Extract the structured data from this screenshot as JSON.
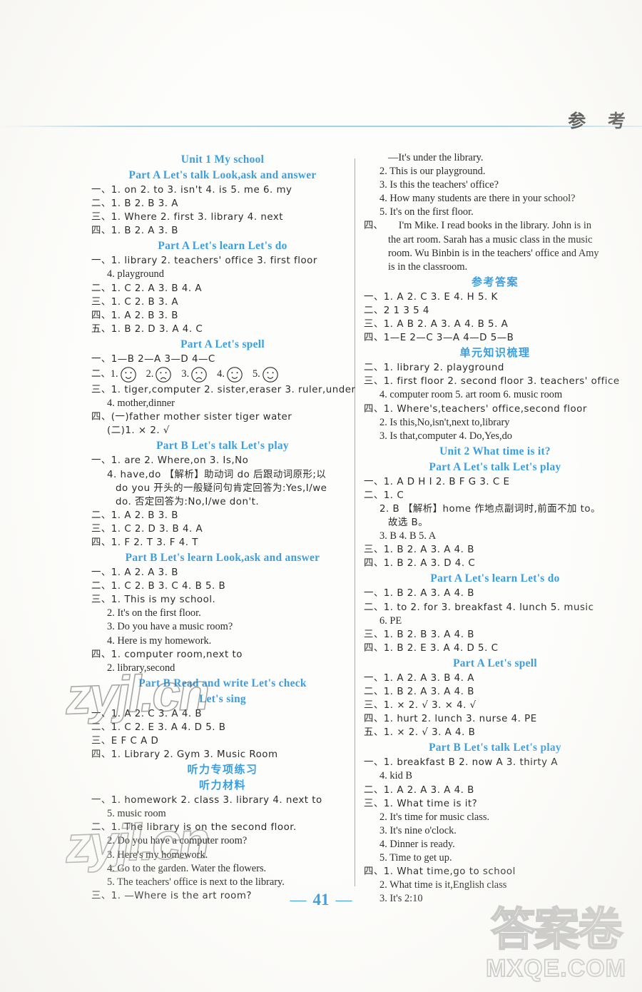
{
  "page": {
    "header_title": "参 考",
    "page_number": "41",
    "page_number_dash": "—"
  },
  "watermarks": {
    "left_upper": "zyjl.cn",
    "left_lower": "zyjl.cn",
    "corner_cn": "答案卷",
    "corner_domain": "MXQE.COM"
  },
  "left_column": [
    {
      "type": "heading",
      "text": "Unit 1   My school"
    },
    {
      "type": "heading",
      "text": "Part A   Let's talk   Look,ask and answer"
    },
    {
      "type": "line",
      "text": "一、1. on  2. to  3. isn't  4. is  5. me  6. my"
    },
    {
      "type": "line",
      "text": "二、1. B  2. B  3. A"
    },
    {
      "type": "line",
      "text": "三、1. Where  2. first  3. library  4. next"
    },
    {
      "type": "line",
      "text": "四、1. B  2. A  3. B"
    },
    {
      "type": "heading",
      "text": "Part A   Let's learn   Let's do"
    },
    {
      "type": "line",
      "text": "一、1. library  2. teachers' office  3. first floor"
    },
    {
      "type": "indent1",
      "text": "4. playground"
    },
    {
      "type": "line",
      "text": "二、1. C  2. A  3. B  4. A"
    },
    {
      "type": "line",
      "text": "三、1. C  2. B  3. A"
    },
    {
      "type": "line",
      "text": "四、1. A  2. B  3. B"
    },
    {
      "type": "line",
      "text": "五、1. B  2. D  3. A  4. C"
    },
    {
      "type": "heading",
      "text": "Part A   Let's spell"
    },
    {
      "type": "line",
      "text": "一、1—B   2—A   3—D   4—C"
    },
    {
      "type": "faces",
      "label": "二、",
      "items": [
        {
          "num": "1.",
          "mood": "smile"
        },
        {
          "num": "2.",
          "mood": "frown"
        },
        {
          "num": "3.",
          "mood": "frown"
        },
        {
          "num": "4.",
          "mood": "smile"
        },
        {
          "num": "5.",
          "mood": "smile"
        }
      ]
    },
    {
      "type": "line",
      "text": "三、1. tiger,computer   2. sister,eraser   3. ruler,under"
    },
    {
      "type": "indent1",
      "text": "4. mother,dinner"
    },
    {
      "type": "line",
      "text": "四、(一)father   mother   sister   tiger   water"
    },
    {
      "type": "indent1",
      "text": "(二)1. ×   2. √"
    },
    {
      "type": "heading",
      "text": "Part B   Let's talk   Let's play"
    },
    {
      "type": "line",
      "text": "一、1. are  2. Where,on  3. Is,No"
    },
    {
      "type": "indent1",
      "text": "4. have,do  【解析】助动词 do 后跟动词原形;以"
    },
    {
      "type": "indent2",
      "text": "do you 开头的一般疑问句肯定回答为:Yes,I/we"
    },
    {
      "type": "indent2",
      "text": "do. 否定回答为:No,I/we don't."
    },
    {
      "type": "line",
      "text": "二、1. A   2. B   3. B"
    },
    {
      "type": "line",
      "text": "三、1. C   2. D   3. B   4. A"
    },
    {
      "type": "line",
      "text": "四、1. F   2. T   3. F   4. T"
    },
    {
      "type": "heading",
      "text": "Part B   Let's learn   Look,ask and answer"
    },
    {
      "type": "line",
      "text": "一、1. A   2. A   3. B"
    },
    {
      "type": "line",
      "text": "二、1. C   2. B   3. C   4. B   5. B"
    },
    {
      "type": "line",
      "text": "三、1. This is my school."
    },
    {
      "type": "indent1",
      "text": "2. It's on the first floor."
    },
    {
      "type": "indent1",
      "text": "3. Do you have a music room?"
    },
    {
      "type": "indent1",
      "text": "4. Here is my homework."
    },
    {
      "type": "line",
      "text": "四、1. computer room,next to"
    },
    {
      "type": "indent1",
      "text": "2. library,second"
    },
    {
      "type": "heading",
      "text": "Part B   Read and write   Let's check"
    },
    {
      "type": "heading",
      "text": "Let's sing"
    },
    {
      "type": "line",
      "text": "一、1. A   2. C   3. A   4. B"
    },
    {
      "type": "line",
      "text": "二、1. C   2. E   3. A   4. D   5. B"
    },
    {
      "type": "line",
      "text": "三、E   F   C   A   D"
    },
    {
      "type": "line",
      "text": "四、1. Library   2. Gym   3. Music Room"
    },
    {
      "type": "heading-cn",
      "text": "听力专项练习"
    },
    {
      "type": "heading-cn",
      "text": "听力材料"
    },
    {
      "type": "line",
      "text": "一、1. homework   2. class   3. library   4. next to"
    },
    {
      "type": "indent1",
      "text": "5. music room"
    },
    {
      "type": "line",
      "text": "二、1. The library is on the second floor."
    },
    {
      "type": "indent1",
      "text": "2. Do you have a computer room?"
    },
    {
      "type": "indent1",
      "text": "3. Here's my homework."
    },
    {
      "type": "indent1",
      "text": "4. Go to the garden. Water the flowers."
    },
    {
      "type": "indent1",
      "text": "5. The teachers' office is next to the library."
    },
    {
      "type": "line",
      "text": "三、1. —Where is the art room?"
    }
  ],
  "right_column": [
    {
      "type": "indent2",
      "text": "—It's under the library."
    },
    {
      "type": "indent1",
      "text": "2. This is our playground."
    },
    {
      "type": "indent1",
      "text": "3. Is this the teachers' office?"
    },
    {
      "type": "indent1",
      "text": "4. How many students are there in your school?"
    },
    {
      "type": "indent1",
      "text": "5. It's on the first floor."
    },
    {
      "type": "justify-first",
      "label": "四、",
      "text": "I'm Mike. I read books in the library. John is in"
    },
    {
      "type": "justify",
      "text": "the art room. Sarah has a music class in the music"
    },
    {
      "type": "justify",
      "text": "room. Wu Binbin is in the teachers' office and Amy"
    },
    {
      "type": "justify",
      "text": "is in the classroom."
    },
    {
      "type": "heading-cn",
      "text": "参考答案"
    },
    {
      "type": "line",
      "text": "一、1. A   2. C   3. E   4. H   5. K"
    },
    {
      "type": "line",
      "text": "二、2   1   3   5   4"
    },
    {
      "type": "line",
      "text": "三、1. A   B   2. A   3. A   4. B   5. A"
    },
    {
      "type": "line",
      "text": "四、1—E   2—C   3—A   4—D   5—B"
    },
    {
      "type": "heading-cn",
      "text": "单元知识梳理"
    },
    {
      "type": "line",
      "text": "二、1. library   2. playground"
    },
    {
      "type": "line",
      "text": "三、1. first floor   2. second floor   3. teachers' office"
    },
    {
      "type": "indent1",
      "text": "4. computer room   5. art room   6. music room"
    },
    {
      "type": "line",
      "text": "四、1. Where's,teachers' office,second floor"
    },
    {
      "type": "indent1",
      "text": "2. Is this,No,isn't,next to,library"
    },
    {
      "type": "indent1",
      "text": "3. Is that,computer   4. Do,Yes,do"
    },
    {
      "type": "heading",
      "text": "Unit 2   What time is it?"
    },
    {
      "type": "heading",
      "text": "Part A   Let's talk   Let's play"
    },
    {
      "type": "line",
      "text": "一、1. A   D   H   I   2. B   F   G   3. C   E"
    },
    {
      "type": "line",
      "text": "二、1. C"
    },
    {
      "type": "indent1",
      "text": "2. B  【解析】home 作地点副词时,前面不加 to。"
    },
    {
      "type": "indent2",
      "text": "故选 B。"
    },
    {
      "type": "indent1",
      "text": "3. B   4. B   5. A"
    },
    {
      "type": "line",
      "text": "三、1. B   2. A   3. A   4. B"
    },
    {
      "type": "line",
      "text": "四、1. B   2. A   3. D   4. C"
    },
    {
      "type": "heading",
      "text": "Part A   Let's learn   Let's do"
    },
    {
      "type": "line",
      "text": "一、1. B   2. A   3. A   4. B"
    },
    {
      "type": "line",
      "text": "二、1. to   2. for   3. breakfast   4. lunch   5. music"
    },
    {
      "type": "indent1",
      "text": "6. PE"
    },
    {
      "type": "line",
      "text": "三、1. B   2. B   3. A   4. B"
    },
    {
      "type": "line",
      "text": "四、1. B   2. E   3. A   4. D   5. C"
    },
    {
      "type": "heading",
      "text": "Part A   Let's spell"
    },
    {
      "type": "line",
      "text": "一、1. A   2. A   3. B   4. A"
    },
    {
      "type": "line",
      "text": "二、1. B   2. A   3. A   4. B"
    },
    {
      "type": "line",
      "text": "三、1. ×   2. √   3. ×   4. √"
    },
    {
      "type": "line",
      "text": "四、1. hurt   2. lunch   3. nurse   4. PE"
    },
    {
      "type": "line",
      "text": "五、1. ×   2. √   3. A   4. B"
    },
    {
      "type": "heading",
      "text": "Part B   Let's talk   Let's play"
    },
    {
      "type": "line",
      "text": "一、1. breakfast   B   2. now   A   3. thirty   A"
    },
    {
      "type": "indent1",
      "text": "4. kid   B"
    },
    {
      "type": "line",
      "text": "二、1. A   2. A   3. A   4. B"
    },
    {
      "type": "line",
      "text": "三、1. What time is it?"
    },
    {
      "type": "indent1",
      "text": "2. It's time for music class."
    },
    {
      "type": "indent1",
      "text": "3. It's nine o'clock."
    },
    {
      "type": "indent1",
      "text": "4. Dinner is ready."
    },
    {
      "type": "indent1",
      "text": "5. Time to get up."
    },
    {
      "type": "line",
      "text": "四、1. What time,go to school"
    },
    {
      "type": "indent1",
      "text": "2. What time is it,English class"
    },
    {
      "type": "indent1",
      "text": "3. It's 2:10"
    }
  ]
}
